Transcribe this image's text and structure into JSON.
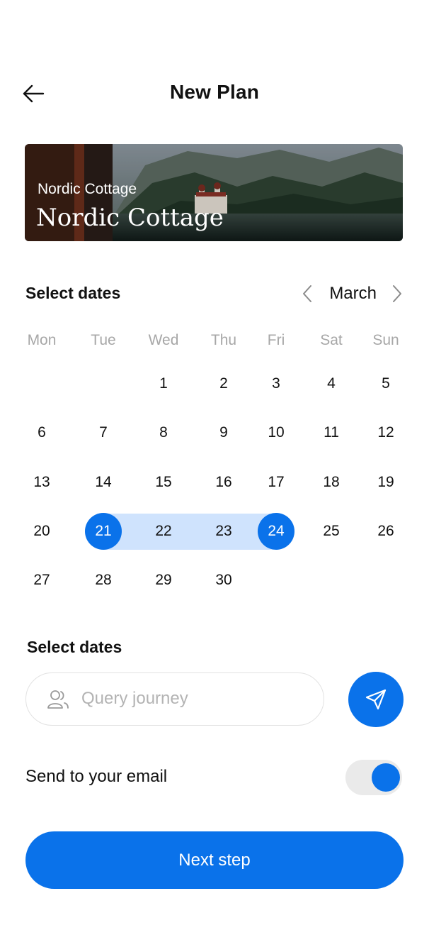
{
  "header": {
    "title": "New Plan",
    "back_icon": "arrow-left-icon"
  },
  "hero": {
    "subtitle": "Nordic Cottage",
    "title": "Nordic Cottage"
  },
  "calendar": {
    "section_label": "Select dates",
    "month": "March",
    "prev_icon": "chevron-left-icon",
    "next_icon": "chevron-right-icon",
    "weekdays": [
      "Mon",
      "Tue",
      "Wed",
      "Thu",
      "Fri",
      "Sat",
      "Sun"
    ],
    "weeks": [
      [
        "",
        "",
        "1",
        "2",
        "3",
        "4",
        "5"
      ],
      [
        "6",
        "7",
        "8",
        "9",
        "10",
        "11",
        "12"
      ],
      [
        "13",
        "14",
        "15",
        "16",
        "17",
        "18",
        "19"
      ],
      [
        "20",
        "21",
        "22",
        "23",
        "24",
        "25",
        "26"
      ],
      [
        "27",
        "28",
        "29",
        "30",
        "",
        "",
        ""
      ]
    ],
    "range_start": "21",
    "range_end": "24"
  },
  "query": {
    "section_label": "Select dates",
    "placeholder": "Query journey",
    "value": "",
    "user_icon": "users-icon",
    "send_icon": "paper-plane-icon"
  },
  "email": {
    "label": "Send to your email",
    "toggle_on": true
  },
  "actions": {
    "next_label": "Next step"
  },
  "colors": {
    "accent": "#0a72ea",
    "range_fill": "#cfe3fd",
    "muted": "#a7a7a7"
  }
}
